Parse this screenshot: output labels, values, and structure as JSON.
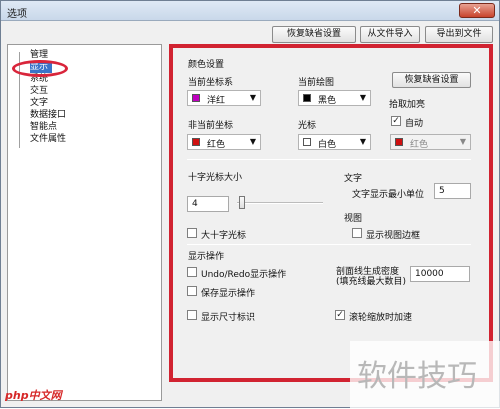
{
  "window": {
    "title": "选项",
    "close_glyph": "✕"
  },
  "toolbar": {
    "restore_defaults": "恢复缺省设置",
    "import_file": "从文件导入",
    "export_file": "导出到文件"
  },
  "tree": {
    "items": [
      "管理",
      "显示",
      "系统",
      "交互",
      "文字",
      "数据接口",
      "智能点",
      "文件属性"
    ],
    "selected": "显示"
  },
  "color_settings": {
    "section": "颜色设置",
    "current_coord_label": "当前坐标系",
    "current_coord_value": "洋红",
    "current_coord_color": "#c000c0",
    "current_drawing_label": "当前绘图",
    "current_drawing_value": "黑色",
    "current_drawing_color": "#000000",
    "restore_button": "恢复缺省设置",
    "noncurrent_coord_label": "非当前坐标",
    "noncurrent_coord_value": "红色",
    "noncurrent_coord_color": "#d01010",
    "cursor_label": "光标",
    "cursor_value": "白色",
    "cursor_color": "#ffffff",
    "pickup_label": "拾取加亮",
    "auto_label": "自动",
    "auto_checked": true,
    "pickup_value": "红色",
    "pickup_color": "#d01010"
  },
  "crosshair": {
    "label": "十字光标大小",
    "size_value": "4",
    "large_label": "大十字光标",
    "large_checked": false
  },
  "text": {
    "section": "文字",
    "min_unit_label": "文字显示最小单位",
    "min_unit_value": "5"
  },
  "view": {
    "section": "视图",
    "show_border_label": "显示视图边框",
    "show_border_checked": false
  },
  "display_ops": {
    "section": "显示操作",
    "undo_redo_label": "Undo/Redo显示操作",
    "undo_redo_checked": false,
    "save_display_label": "保存显示操作",
    "save_display_checked": false,
    "show_dim_label": "显示尺寸标识",
    "show_dim_checked": false
  },
  "hatch": {
    "label_line1": "剖面线生成密度",
    "label_line2": "(填充线最大数目)",
    "value": "10000"
  },
  "wheel": {
    "label": "滚轮缩放时加速",
    "checked": true
  },
  "watermark": {
    "text": "软件技巧",
    "logo": "php中文网"
  }
}
